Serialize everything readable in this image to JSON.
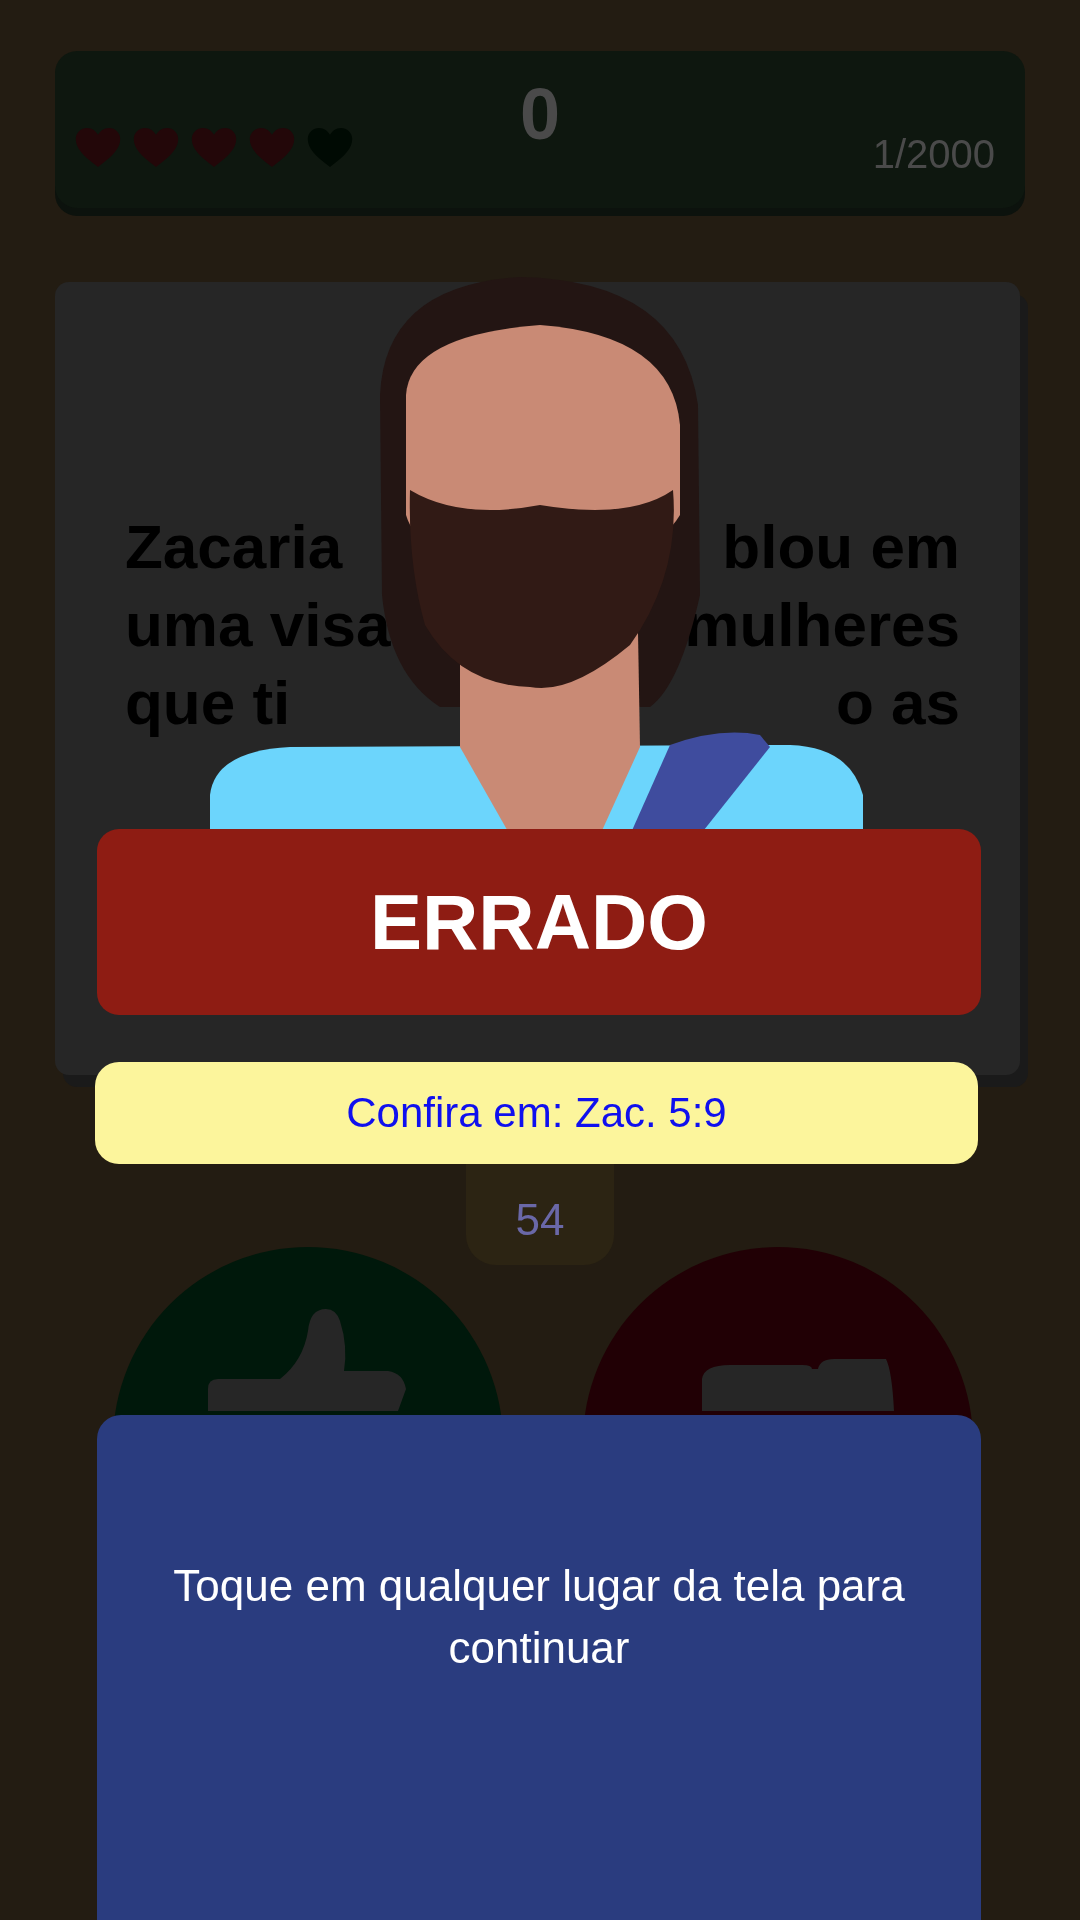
{
  "status_bar": {
    "hearts": [
      {
        "full": true
      },
      {
        "full": true
      },
      {
        "full": true
      },
      {
        "full": true
      },
      {
        "full": false
      }
    ],
    "score": "0",
    "progress": "1/2000"
  },
  "question": {
    "lines": [
      {
        "left": "Zacaria",
        "right": "blou em"
      },
      {
        "left": "uma visa",
        "right": "mulheres"
      },
      {
        "left": "que ti",
        "right": "o as"
      }
    ]
  },
  "timer": "54",
  "answer_buttons": [
    {
      "kind": "yes"
    },
    {
      "kind": "no"
    }
  ],
  "result": {
    "verdict": "ERRADO",
    "correct": false,
    "reference": "Confira em: Zac. 5:9",
    "hint": "Toque em qualquer lugar da tela para continuar"
  }
}
